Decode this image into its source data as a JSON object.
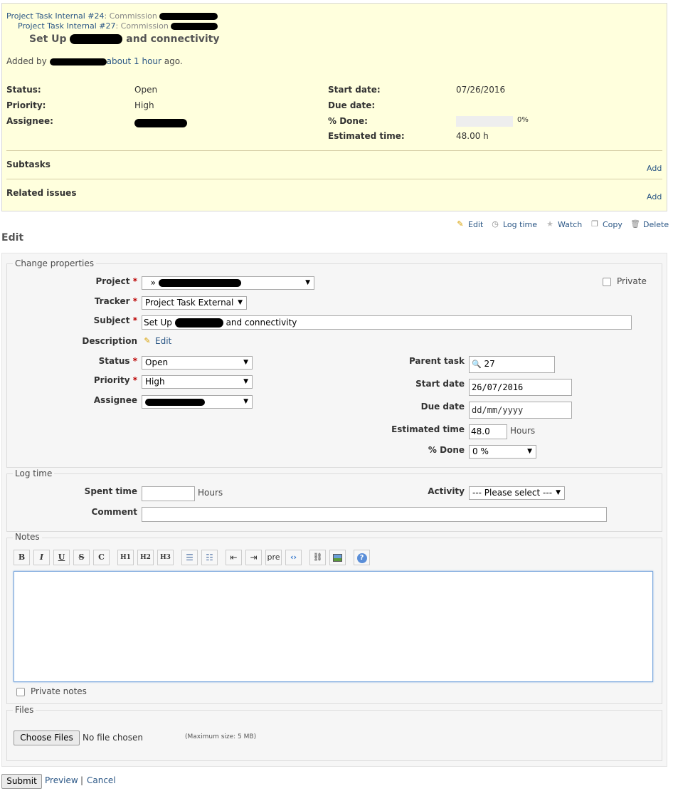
{
  "issue": {
    "parents": [
      {
        "link": "Project Task Internal #24",
        "suffix": ": Commission"
      },
      {
        "link": "Project Task Internal #27",
        "suffix": ": Commission"
      }
    ],
    "subject_prefix": "Set Up",
    "subject_suffix": "and connectivity",
    "added_by_prefix": "Added by",
    "added_time_link": "about 1 hour",
    "added_time_suffix": "ago.",
    "attributes_left": [
      {
        "label": "Status:",
        "value": "Open"
      },
      {
        "label": "Priority:",
        "value": "High"
      },
      {
        "label": "Assignee:",
        "value": ""
      }
    ],
    "attributes_right": [
      {
        "label": "Start date:",
        "value": "07/26/2016"
      },
      {
        "label": "Due date:",
        "value": ""
      },
      {
        "label": "% Done:",
        "value": "0%"
      },
      {
        "label": "Estimated time:",
        "value": "48.00 h"
      }
    ],
    "done_ratio": 0,
    "subtasks_label": "Subtasks",
    "subtasks_add": "Add",
    "related_label": "Related issues",
    "related_add": "Add"
  },
  "contextual": {
    "edit": "Edit",
    "log_time": "Log time",
    "watch": "Watch",
    "copy": "Copy",
    "delete": "Delete"
  },
  "edit_heading": "Edit",
  "properties": {
    "legend": "Change properties",
    "project_label": "Project",
    "project_value": "»",
    "private_label": "Private",
    "tracker_label": "Tracker",
    "tracker_value": "Project Task External",
    "subject_label": "Subject",
    "subject_value_prefix": "Set Up",
    "subject_value_suffix": "and connectivity",
    "description_label": "Description",
    "description_edit": "Edit",
    "status_label": "Status",
    "status_value": "Open",
    "priority_label": "Priority",
    "priority_value": "High",
    "assignee_label": "Assignee",
    "assignee_value": "",
    "parent_label": "Parent task",
    "parent_value": "27",
    "start_label": "Start date",
    "start_value": "26/07/2016",
    "due_label": "Due date",
    "due_placeholder": "dd/mm/yyyy",
    "estimated_label": "Estimated time",
    "estimated_value": "48.0",
    "estimated_unit": "Hours",
    "done_label": "% Done",
    "done_value": "0 %"
  },
  "logtime": {
    "legend": "Log time",
    "spent_label": "Spent time",
    "spent_unit": "Hours",
    "activity_label": "Activity",
    "activity_value": "--- Please select ---",
    "comment_label": "Comment"
  },
  "notes": {
    "legend": "Notes",
    "toolbar": [
      "B",
      "I",
      "U",
      "S",
      "C",
      "H1",
      "H2",
      "H3",
      "ul",
      "ol",
      "outdent",
      "indent",
      "pre",
      "code",
      "link",
      "image",
      "help"
    ],
    "private_label": "Private notes"
  },
  "files": {
    "legend": "Files",
    "choose": "Choose Files",
    "none": "No file chosen",
    "max": "(Maximum size: 5 MB)"
  },
  "actions": {
    "submit": "Submit",
    "preview": "Preview",
    "separator": "|",
    "cancel": "Cancel"
  }
}
